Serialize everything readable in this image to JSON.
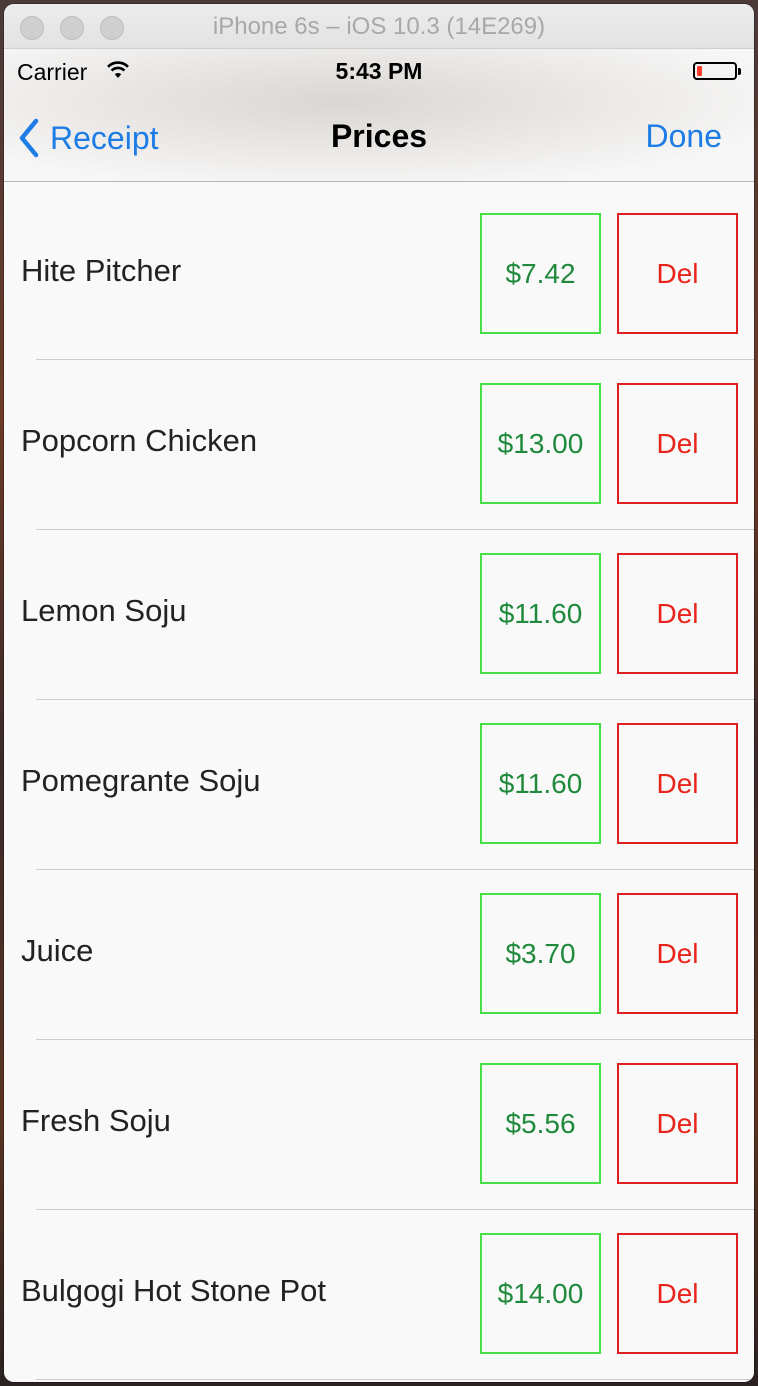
{
  "window": {
    "title": "iPhone 6s – iOS 10.3 (14E269)"
  },
  "status_bar": {
    "carrier": "Carrier",
    "time": "5:43 PM",
    "battery_level": 0.15,
    "battery_color": "#ff3b30"
  },
  "nav": {
    "back_label": "Receipt",
    "title": "Prices",
    "done_label": "Done",
    "tint_color": "#1d7ce5"
  },
  "items": [
    {
      "name": "Hite Pitcher",
      "price": "$7.42",
      "delete_label": "Del"
    },
    {
      "name": "Popcorn Chicken",
      "price": "$13.00",
      "delete_label": "Del"
    },
    {
      "name": "Lemon Soju",
      "price": "$11.60",
      "delete_label": "Del"
    },
    {
      "name": "Pomegrante Soju",
      "price": "$11.60",
      "delete_label": "Del"
    },
    {
      "name": "Juice",
      "price": "$3.70",
      "delete_label": "Del"
    },
    {
      "name": "Fresh Soju",
      "price": "$5.56",
      "delete_label": "Del"
    },
    {
      "name": "Bulgogi Hot Stone Pot",
      "price": "$14.00",
      "delete_label": "Del"
    }
  ],
  "colors": {
    "price_border": "#44e044",
    "price_text": "#1f8a3c",
    "delete_border": "#e02020",
    "delete_text": "#e8251c"
  },
  "icons": {
    "back": "chevron-left-icon",
    "wifi": "wifi-icon",
    "battery": "battery-icon"
  }
}
